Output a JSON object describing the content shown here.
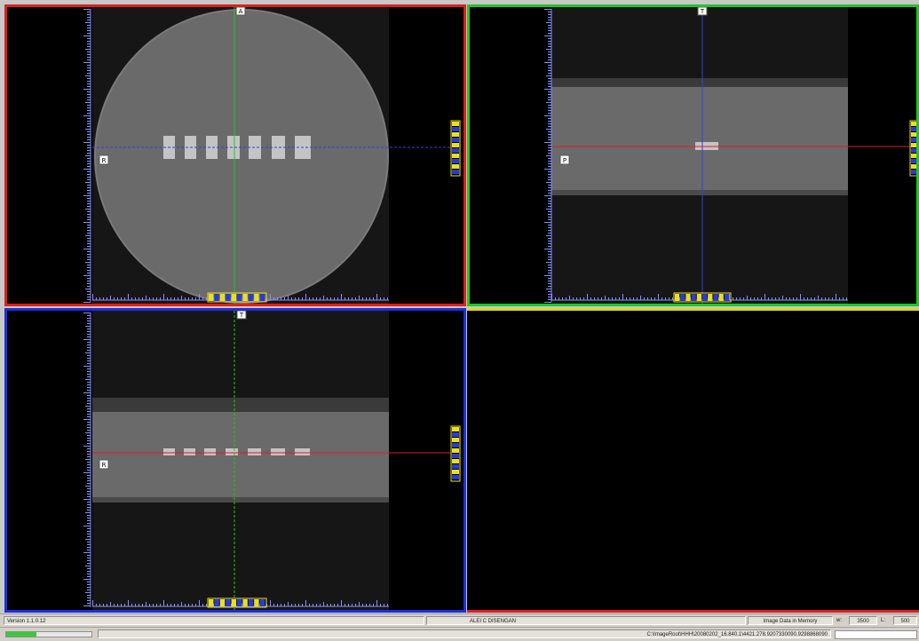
{
  "viewports": {
    "axial": {
      "orientation_marker": "A",
      "side_marker": "R",
      "frame_color": "#e01e1e"
    },
    "coronal": {
      "orientation_marker": "T",
      "side_marker": "P",
      "frame_color": "#1ec81e"
    },
    "sagittal": {
      "orientation_marker": "T",
      "side_marker": "R",
      "frame_color": "#1e2ee0"
    }
  },
  "status": {
    "version": "Version 1.1.0.12",
    "alert": "ALEI C DISENGAN",
    "memory": "Image Data in Memory",
    "w_label": "w:",
    "w_value": "3500",
    "l_label": "L:",
    "l_value": "500",
    "file_path": "C:\\ImageRoot\\HHH\\20080202_16.840.1\\4421.278.9207330090.9298868090",
    "progress_fraction": 0.35
  },
  "colors": {
    "crosshair_red": "#e01e1e",
    "crosshair_green": "#1ec81e",
    "crosshair_blue": "#3a3ae8",
    "ruler_tick": "#8890ff",
    "scale_bar": "#e8e020"
  }
}
